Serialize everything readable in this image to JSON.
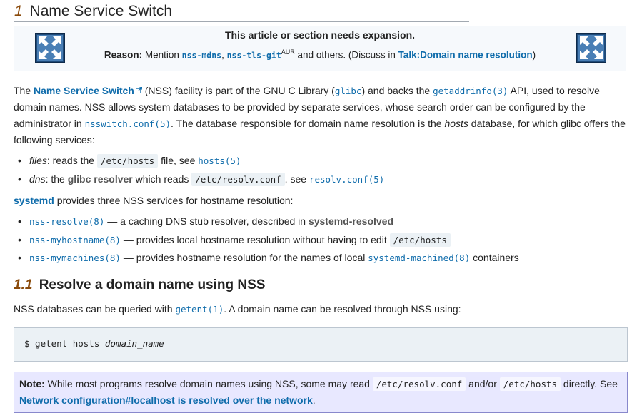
{
  "section1": {
    "number": "1",
    "title": "Name Service Switch"
  },
  "expansion": {
    "title": "This article or section needs expansion.",
    "reason_label": "Reason:",
    "reason_text1": "Mention",
    "link1": "nss-mdns",
    "sep": ",",
    "link2": "nss-tls-git",
    "sup": "AUR",
    "reason_text2": "and others. (Discuss in",
    "discuss_link": "Talk:Domain name resolution",
    "close_paren": ")"
  },
  "intro": {
    "t1": "The",
    "link_nss": "Name Service Switch",
    "t2": "(NSS) facility is part of the GNU C Library (",
    "link_glibc": "glibc",
    "t3": ") and backs the",
    "link_getaddrinfo": "getaddrinfo(3)",
    "t4": "API, used to resolve domain names. NSS allows system databases to be provided by separate services, whose search order can be configured by the administrator in",
    "link_nsswitch": "nsswitch.conf(5)",
    "t5": ". The database responsible for domain name resolution is the",
    "em_hosts": "hosts",
    "t6": "database, for which glibc offers the following services:"
  },
  "services": [
    {
      "em": "files",
      "t1": ": reads the",
      "code": "/etc/hosts",
      "t2": "file, see",
      "link": "hosts(5)"
    },
    {
      "em": "dns",
      "t1": ": the",
      "bold": "glibc resolver",
      "t2": "which reads",
      "code": "/etc/resolv.conf",
      "t3": ", see",
      "link": "resolv.conf(5)"
    }
  ],
  "systemd_para": {
    "link": "systemd",
    "text": "provides three NSS services for hostname resolution:"
  },
  "systemd_services": [
    {
      "link": "nss-resolve(8)",
      "t1": "— a caching DNS stub resolver, described in",
      "bold": "systemd-resolved"
    },
    {
      "link": "nss-myhostname(8)",
      "t1": "— provides local hostname resolution without having to edit",
      "code": "/etc/hosts"
    },
    {
      "link": "nss-mymachines(8)",
      "t1": "— provides hostname resolution for the names of local",
      "link2": "systemd-machined(8)",
      "t2": "containers"
    }
  ],
  "section11": {
    "number": "1.1",
    "title": "Resolve a domain name using NSS"
  },
  "nss_query": {
    "t1": "NSS databases can be queried with",
    "link": "getent(1)",
    "t2": ". A domain name can be resolved through NSS using:"
  },
  "code_block": {
    "cmd": "$ getent hosts",
    "arg": "domain_name"
  },
  "note": {
    "label": "Note:",
    "t1": "While most programs resolve domain names using NSS, some may read",
    "code1": "/etc/resolv.conf",
    "t2": "and/or",
    "code2": "/etc/hosts",
    "t3": "directly. See",
    "link": "Network configuration#localhost is resolved over the network",
    "t4": "."
  },
  "colors": {
    "link": "#0f6cab",
    "note_bg": "#e8e8ff",
    "code_bg": "#ebf1f5",
    "heading_num": "#8a4a0a"
  },
  "icons": {
    "expansion": "expand-arrows-icon",
    "external": "external-link-icon"
  }
}
